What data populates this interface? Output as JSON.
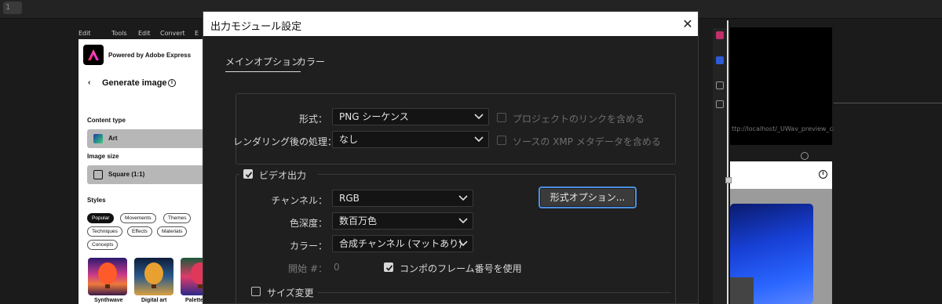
{
  "top": {
    "line_number": "1"
  },
  "background_menu": [
    "Edit",
    "Tools",
    "Edit",
    "Convert",
    "E"
  ],
  "adobe_express": {
    "powered_by": "Powered by Adobe Express",
    "back_glyph": "‹",
    "title": "Generate image",
    "info_glyph": "i",
    "content_type_label": "Content type",
    "content_type_value": "Art",
    "image_size_label": "Image size",
    "image_size_value": "Square (1:1)",
    "styles_label": "Styles",
    "style_chips": [
      "Popular",
      "Movements",
      "Themes",
      "Techniques",
      "Effects",
      "Materials",
      "Concepts"
    ],
    "thumbnails": [
      "Synthwave",
      "Digital art",
      "Palette"
    ]
  },
  "right_bg": {
    "url_fragment": "ttp://localhost/_UWav_preview_cabs",
    "info_glyph": "i"
  },
  "dialog": {
    "title": "出力モジュール設定",
    "close_glyph": "✕",
    "tabs": [
      {
        "label": "メインオプション",
        "active": true
      },
      {
        "label": "カラー",
        "active": false
      }
    ],
    "format_label": "形式：",
    "format_value": "PNG シーケンス",
    "post_render_label": "レンダリング後の処理：",
    "post_render_value": "なし",
    "include_project_link": "プロジェクトのリンクを含める",
    "include_xmp": "ソースの XMP メタデータを含める",
    "video_output_label": "ビデオ出力",
    "video_output_checked": true,
    "channels_label": "チャンネル：",
    "channels_value": "RGB",
    "depth_label": "色深度：",
    "depth_value": "数百万色",
    "color_label": "カラー：",
    "color_value": "合成チャンネル (マットあり)",
    "start_label": "開始 #：",
    "start_value": "0",
    "use_comp_frame": "コンポのフレーム番号を使用",
    "use_comp_frame_checked": true,
    "format_options_button": "形式オプション...",
    "resize_label": "サイズ変更",
    "resize_checked": false,
    "accent_color": "#4b8fe2"
  }
}
